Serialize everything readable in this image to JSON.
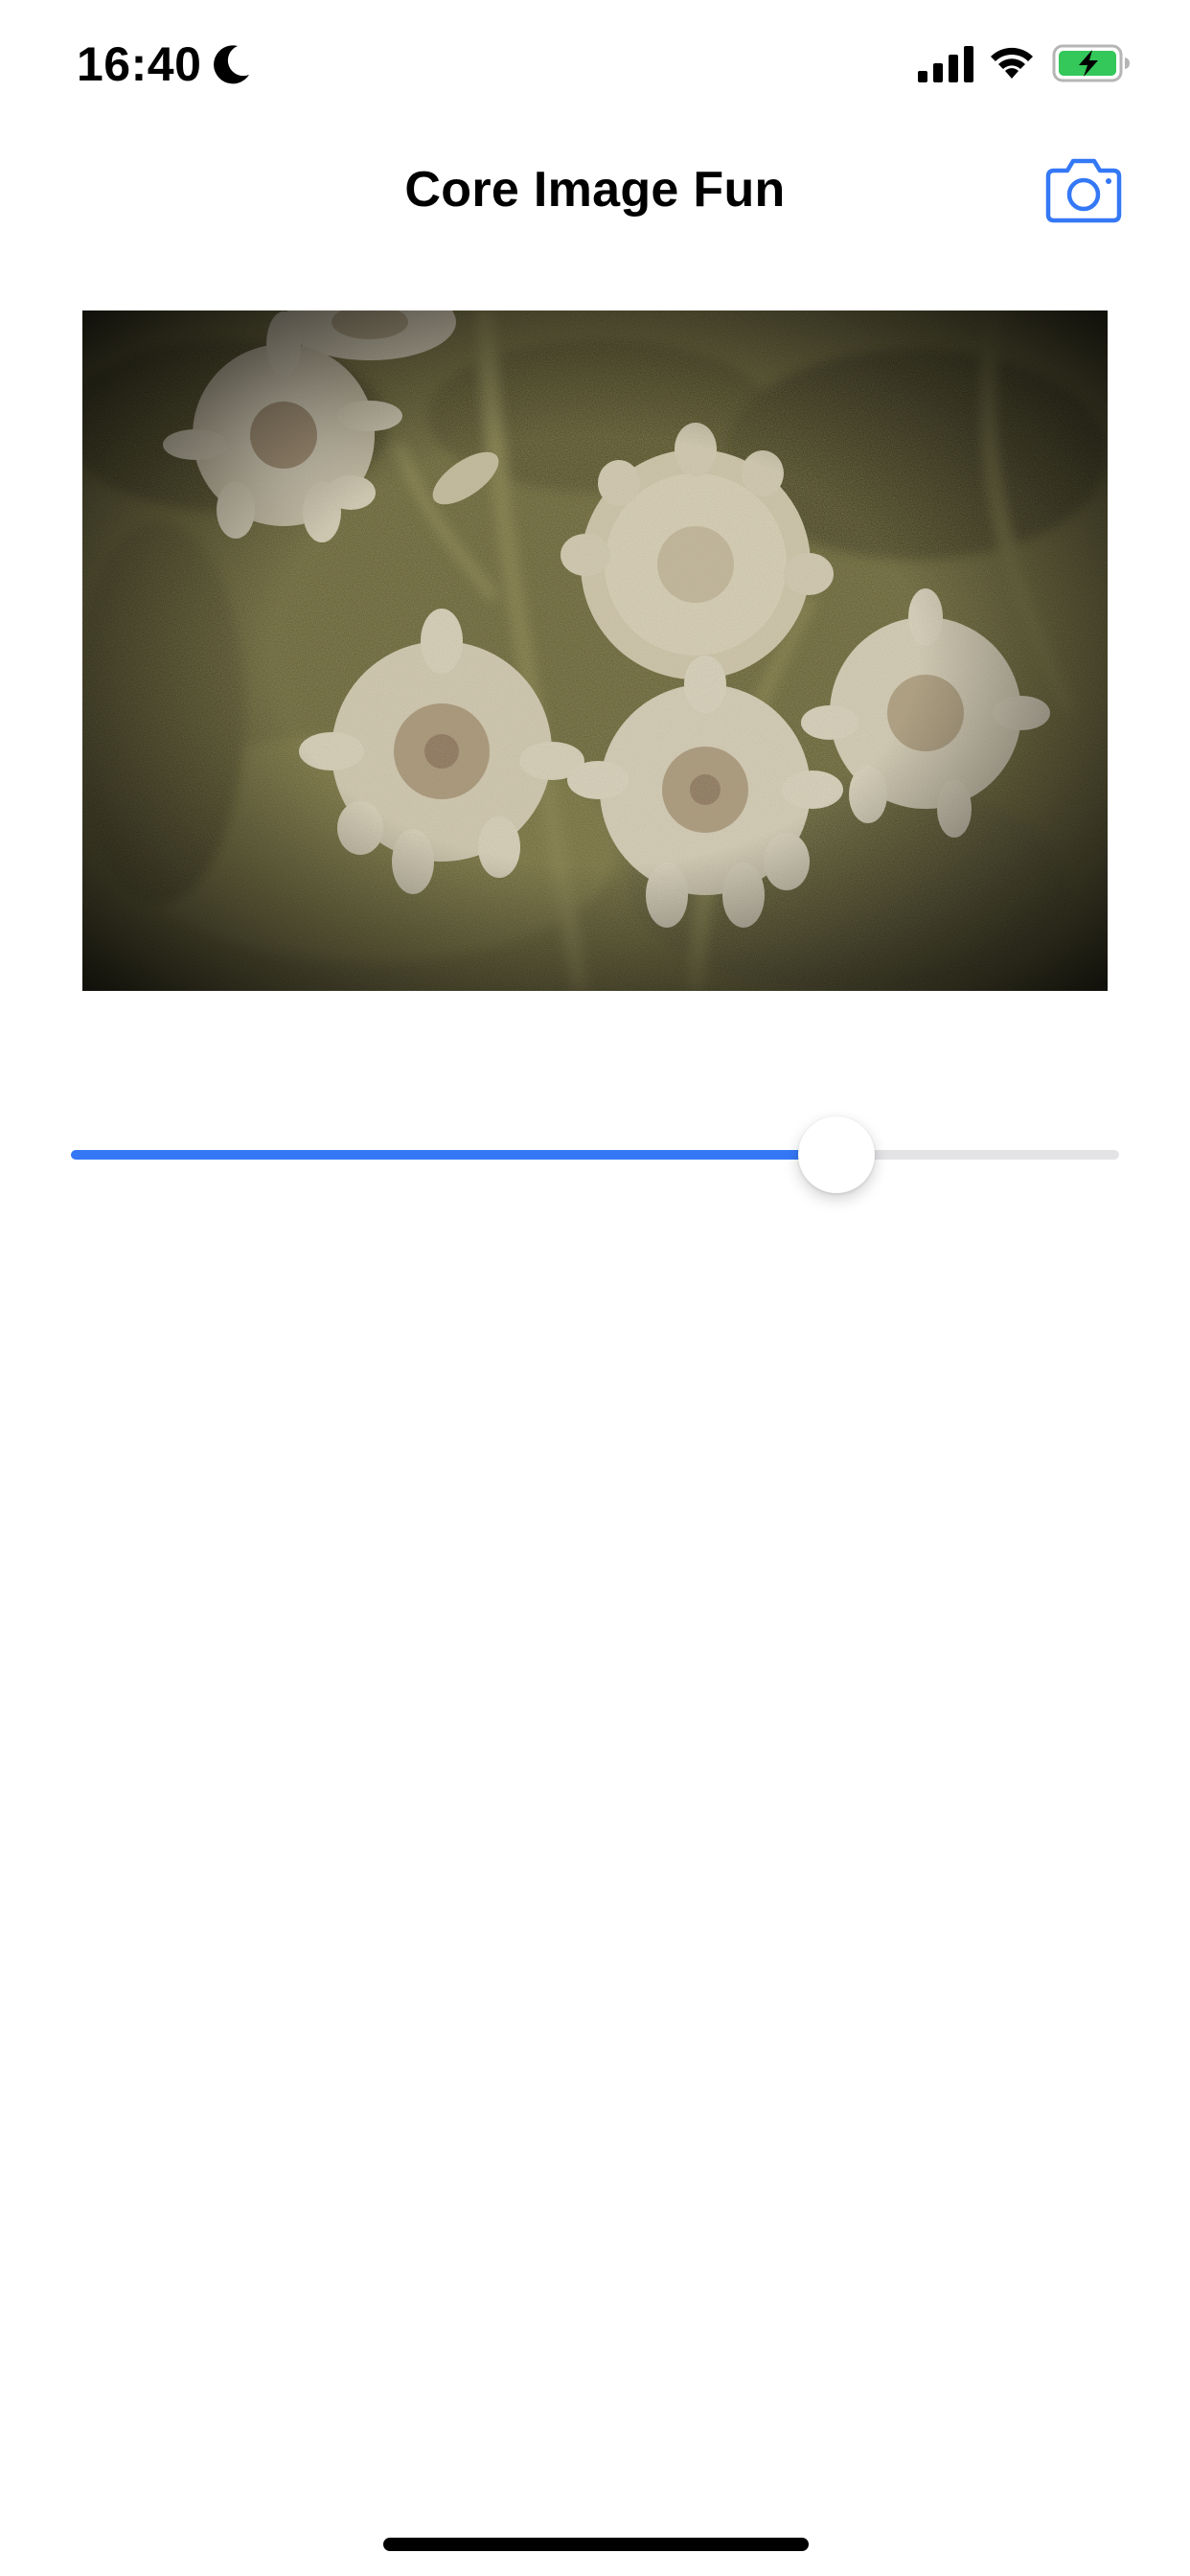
{
  "status_bar": {
    "time": "16:40",
    "focus_icon": "moon-icon",
    "signal_icon": "cellular-signal-icon",
    "wifi_icon": "wifi-icon",
    "battery_icon": "battery-charging-icon",
    "battery_color": "#34c759"
  },
  "nav": {
    "title": "Core Image Fun",
    "camera_icon": "camera-icon"
  },
  "slider": {
    "value": 0.73,
    "accent_color": "#3478f6",
    "track_color": "#e3e3e6"
  }
}
